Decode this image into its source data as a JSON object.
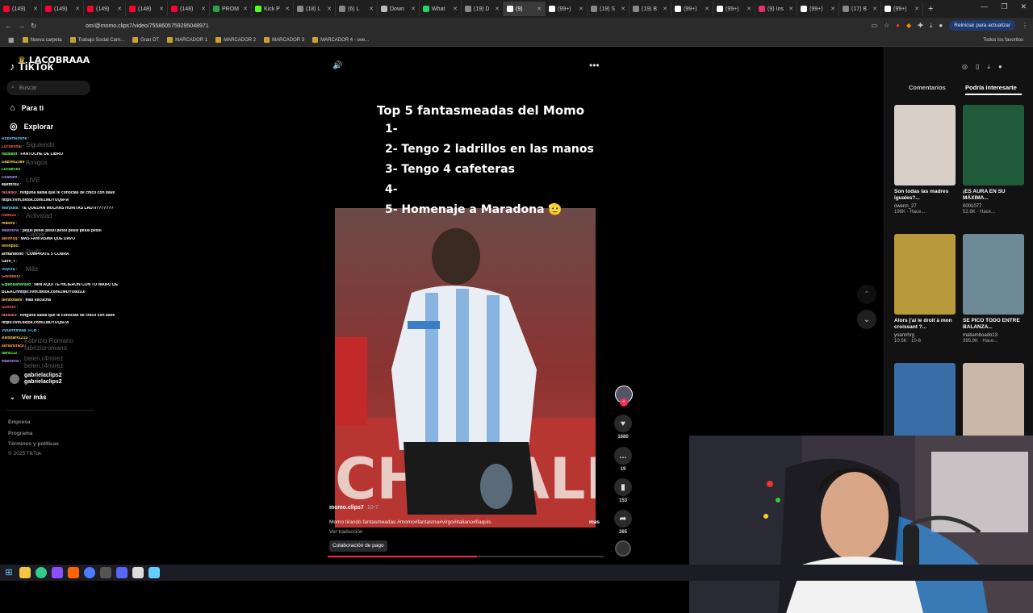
{
  "browser": {
    "tabs": [
      {
        "label": "(149)",
        "color": "#ff0033"
      },
      {
        "label": "(149)",
        "color": "#ff0033"
      },
      {
        "label": "(149)",
        "color": "#ff0033"
      },
      {
        "label": "(148)",
        "color": "#ff0033"
      },
      {
        "label": "(148)",
        "color": "#ff0033"
      },
      {
        "label": "PROM",
        "color": "#2ea043"
      },
      {
        "label": "Kick P",
        "color": "#53fc18"
      },
      {
        "label": "(18) L",
        "color": "#888888"
      },
      {
        "label": "(6) L",
        "color": "#888888"
      },
      {
        "label": "Down",
        "color": "#bbbbbb"
      },
      {
        "label": "What",
        "color": "#25d366"
      },
      {
        "label": "(19) D",
        "color": "#888888"
      },
      {
        "label": "(9)",
        "color": "#ffffff"
      },
      {
        "label": "(99+)",
        "color": "#ffffff"
      },
      {
        "label": "(19) S",
        "color": "#888888"
      },
      {
        "label": "(19) B",
        "color": "#888888"
      },
      {
        "label": "(99+)",
        "color": "#ffffff"
      },
      {
        "label": "(99+)",
        "color": "#ffffff"
      },
      {
        "label": "(9) Ins",
        "color": "#e1306c"
      },
      {
        "label": "(99+)",
        "color": "#ffffff"
      },
      {
        "label": "(17) B",
        "color": "#888888"
      },
      {
        "label": "(99+)",
        "color": "#ffffff"
      }
    ],
    "url": "om/@momo.clips7/video/7558605759295048971",
    "reiniciar": "Reiniciar para actualizar",
    "bookmarks": [
      "Nueva carpeta",
      "Trabajo Social Com...",
      "Gran DT",
      "MARCADOR 1",
      "MARCADOR 2",
      "MARCADOR 3",
      "MARCADOR 4 - ove..."
    ],
    "todos_favoritos": "Todos los favoritos"
  },
  "watermark": "LACOBRAAA",
  "sidebar": {
    "logo": "TikTok",
    "search_placeholder": "Buscar",
    "nav": [
      {
        "label": "Para ti"
      },
      {
        "label": "Explorar"
      }
    ],
    "ghost_nav": [
      "Siguiendo",
      "Amigos",
      "LIVE",
      "Actividad",
      "Cargar",
      "Perfil",
      "Más"
    ],
    "ghost_following": [
      "Fabrizio Romano",
      "fabrizioromano",
      "belen.r4mirez",
      "belen.r4mirez"
    ],
    "following_user": {
      "name": "gabrielaclips2",
      "handle": "gabrielaclips2"
    },
    "ver_mas": "Ver más",
    "footer": [
      "Empresa",
      "Programa",
      "Términos y políticas",
      "© 2025 TikTok"
    ]
  },
  "chat": [
    {
      "user": "RobertRoshe",
      "msg": "",
      "color": "#5ad1ff"
    },
    {
      "user": "Lucasonal",
      "msg": "",
      "color": "#ff5a5a"
    },
    {
      "user": "nadiabd",
      "msg": "FANTOCHE DE LIBRO",
      "color": "#66ff66"
    },
    {
      "user": "Gabriel2389",
      "msg": "",
      "color": "#ffd24d"
    },
    {
      "user": "Luciarcez",
      "msg": "",
      "color": "#66ff66"
    },
    {
      "user": "Dsaltanl",
      "msg": "",
      "color": "#b18cff"
    },
    {
      "user": "Matthrou",
      "msg": "",
      "color": "#ffffff"
    },
    {
      "user": "falukik9",
      "msg": "ninguna sabia que te conocías de chico con dave",
      "color": "#ff7a7a"
    },
    {
      "user": "",
      "msg": "https://vm.tiktok.com/ZMDYUQ6F9/",
      "color": "#ffffff"
    },
    {
      "user": "Marplata",
      "msg": "TE QUEDAN MUCHAS HORITAS LAUTI???????",
      "color": "#5ad1ff"
    },
    {
      "user": "robbi25",
      "msg": "",
      "color": "#ff5a5a"
    },
    {
      "user": "matoni",
      "msg": "",
      "color": "#ffd24d"
    },
    {
      "user": "waltoons",
      "msg": "pessi pessi pessi pessi pessi pessi pessi",
      "color": "#b18cff"
    },
    {
      "user": "aaronsq",
      "msg": "MAS FANTASMA QUE DAVO",
      "color": "#ff9f40"
    },
    {
      "user": "leninpso",
      "msg": "",
      "color": "#ffd24d"
    },
    {
      "user": "armandoflo",
      "msg": "COMPRATE 5 COBRA",
      "color": "#ffffff"
    },
    {
      "user": "Gero_f",
      "msg": "",
      "color": "#ffffff"
    },
    {
      "user": "Vuycra",
      "msg": "",
      "color": "#5ad1ff"
    },
    {
      "user": "Golinder2",
      "msg": "",
      "color": "#ff7a7a"
    },
    {
      "user": "ElpanBananlad",
      "msg": "NINI AQUI TE HICIERON CON TU WAIFU DE",
      "color": "#66ff66"
    },
    {
      "user": "",
      "msg": "BLEACHhttps://vm.tiktok.com/ZMDYU8uSJ/",
      "color": "#ffffff"
    },
    {
      "user": "benitodanl",
      "msg": "mas escucha",
      "color": "#ffd24d"
    },
    {
      "user": "Sunrun",
      "msg": "",
      "color": "#ff5a5a"
    },
    {
      "user": "falukik9",
      "msg": "ninguna sabia que te conocías de chico con dave",
      "color": "#ff7a7a"
    },
    {
      "user": "",
      "msg": "https://vm.tiktok.com/ZMDYUQ6F9/",
      "color": "#ffffff"
    },
    {
      "user": "Vyalentinaaa_FCB",
      "msg": "",
      "color": "#5ad1ff"
    },
    {
      "user": "Alexdark1215",
      "msg": "",
      "color": "#ffd24d"
    },
    {
      "user": "adrianxface",
      "msg": "",
      "color": "#ff9f40"
    },
    {
      "user": "danz112",
      "msg": "",
      "color": "#66ff66"
    },
    {
      "user": "waltoons",
      "msg": "",
      "color": "#b18cff"
    }
  ],
  "video": {
    "overlay_title": "Top 5 fantasmeadas del Momo",
    "overlay_items": [
      "1-",
      "2- Tengo 2 ladrillos en las manos",
      "3- Tengo 4 cafeteras",
      "4-",
      "5- Homenaje a Maradona 🫡"
    ],
    "banner_text": "CHERALI",
    "author": "momo.clips7",
    "date": "10-7",
    "description": "Momo tirando fantasmeadas #momo#fantasma#virgo#italiano#fiaquis",
    "mas": "más",
    "ver_traduccion": "Ver traducción",
    "colab": "Colaboración de pago",
    "progress": 0.54,
    "likes": "1680",
    "comments": "19",
    "saves": "153",
    "shares": "265"
  },
  "right_panel": {
    "tabs": [
      "Comentarios",
      "Podría interesarte"
    ],
    "cards": [
      {
        "title": "Son todas las madres iguales?...",
        "user": "owenn_27",
        "meta": "196K · Hace...",
        "bg": "#d8d0c8"
      },
      {
        "title": "¡ES AURA EN SU MÁXIMA...",
        "user": "0001077",
        "meta": "52.6K · Hace...",
        "bg": "#1f5a3a"
      },
      {
        "title": "Alors j'ai le droit à mon croissant ?...",
        "user": "yoannhrg",
        "meta": "10.5K · 10-8",
        "bg": "#b89a3a"
      },
      {
        "title": "SE PICO TODO ENTRE BALANZA...",
        "user": "matiamboado13",
        "meta": "395.9K · Hace...",
        "bg": "#6d8a96"
      },
      {
        "title": "",
        "user": "",
        "meta": "",
        "bg": "#3a6ea8"
      },
      {
        "title": "",
        "user": "",
        "meta": "",
        "bg": "#c8b6a8"
      }
    ]
  },
  "colors": {
    "accent": "#fe2c55",
    "bg": "#000000",
    "panel": "#121212"
  }
}
